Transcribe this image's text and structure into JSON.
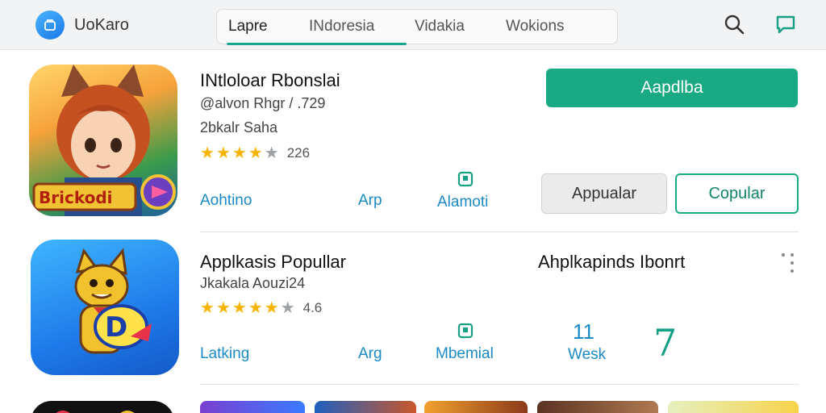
{
  "header": {
    "brand": "UoKaro",
    "tabs": [
      {
        "label": "Lapre",
        "active": true
      },
      {
        "label": "INdoresia",
        "active": false
      },
      {
        "label": "Vidakia",
        "active": false
      },
      {
        "label": "Wokions",
        "active": false
      }
    ],
    "icons": [
      "search-icon",
      "chat-icon"
    ]
  },
  "app1": {
    "title": "INtloloar Rbonslai",
    "developer": "@alvon Rhgr / .729",
    "category": "2bkalr Saha",
    "rating": 3.5,
    "rating_value": "226",
    "icon_badge": "Brickodi",
    "meta": [
      "Aohtino",
      "Arp",
      "Alamoti"
    ],
    "primary_button": "Aapdlba",
    "secondary_button": "Appualar",
    "outline_button": "Copular"
  },
  "app2": {
    "title": "Applkasis Popullar",
    "side_title": "Ahplkapinds Ibonrt",
    "developer": "Jkakala Aouzi24",
    "rating": 4.5,
    "rating_value": "4.6",
    "meta": [
      "Latking",
      "Arg",
      "Mbemial"
    ],
    "stat_number": "11",
    "stat_label": "Wesk",
    "stat_glyph": "7"
  },
  "colors": {
    "accent": "#1aaa83",
    "link": "#1b8ac4",
    "star": "#f4b400"
  }
}
